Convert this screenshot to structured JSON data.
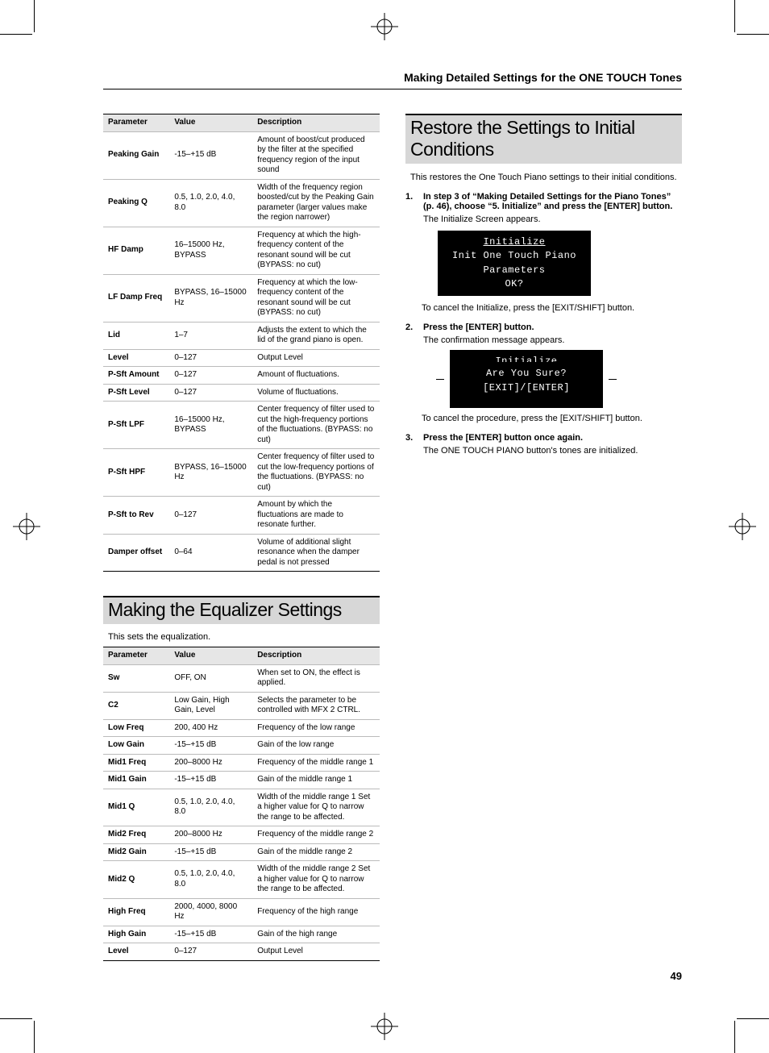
{
  "running_head": "Making Detailed Settings for the ONE TOUCH Tones",
  "page_number": "49",
  "table_top": {
    "headers": [
      "Parameter",
      "Value",
      "Description"
    ],
    "rows": [
      {
        "p": "Peaking Gain",
        "v": "-15–+15 dB",
        "d": "Amount of boost/cut produced by the filter at the specified frequency region of the input sound"
      },
      {
        "p": "Peaking Q",
        "v": "0.5, 1.0, 2.0, 4.0, 8.0",
        "d": "Width of the frequency region boosted/cut by the Peaking Gain parameter (larger values make the region narrower)"
      },
      {
        "p": "HF Damp",
        "v": "16–15000 Hz, BYPASS",
        "d": "Frequency at which the high-frequency content of the resonant sound will be cut (BYPASS: no cut)"
      },
      {
        "p": "LF Damp Freq",
        "v": "BYPASS, 16–15000 Hz",
        "d": "Frequency at which the low-frequency content of the resonant sound will be cut (BYPASS: no cut)"
      },
      {
        "p": "Lid",
        "v": "1–7",
        "d": "Adjusts the extent to which the lid of the grand piano is open."
      },
      {
        "p": "Level",
        "v": "0–127",
        "d": "Output Level"
      },
      {
        "p": "P-Sft Amount",
        "v": "0–127",
        "d": "Amount of fluctuations."
      },
      {
        "p": "P-Sft Level",
        "v": "0–127",
        "d": "Volume of fluctuations."
      },
      {
        "p": "P-Sft LPF",
        "v": "16–15000 Hz, BYPASS",
        "d": "Center frequency of filter used to cut the high-frequency portions of the fluctuations. (BYPASS: no cut)"
      },
      {
        "p": "P-Sft HPF",
        "v": "BYPASS, 16–15000 Hz",
        "d": "Center frequency of filter used to cut the low-frequency portions of the fluctuations. (BYPASS: no cut)"
      },
      {
        "p": "P-Sft to Rev",
        "v": "0–127",
        "d": "Amount by which the fluctuations are made to resonate further."
      },
      {
        "p": "Damper offset",
        "v": "0–64",
        "d": "Volume of additional slight resonance when the damper pedal is not pressed"
      }
    ]
  },
  "eq_heading": "Making the Equalizer Settings",
  "eq_intro": "This sets the equalization.",
  "table_eq": {
    "headers": [
      "Parameter",
      "Value",
      "Description"
    ],
    "rows": [
      {
        "p": "Sw",
        "v": "OFF, ON",
        "d": "When set to ON, the effect is applied."
      },
      {
        "p": "C2",
        "v": "Low Gain, High Gain, Level",
        "d": "Selects the parameter to be controlled with MFX 2 CTRL."
      },
      {
        "p": "Low Freq",
        "v": "200, 400 Hz",
        "d": "Frequency of the low range"
      },
      {
        "p": "Low Gain",
        "v": "-15–+15 dB",
        "d": "Gain of the low range"
      },
      {
        "p": "Mid1 Freq",
        "v": "200–8000 Hz",
        "d": "Frequency of the middle range 1"
      },
      {
        "p": "Mid1 Gain",
        "v": "-15–+15 dB",
        "d": "Gain of the middle range 1"
      },
      {
        "p": "Mid1 Q",
        "v": "0.5, 1.0, 2.0, 4.0, 8.0",
        "d": "Width of the middle range 1\nSet a higher value for Q to narrow the range to be affected."
      },
      {
        "p": "Mid2 Freq",
        "v": "200–8000 Hz",
        "d": "Frequency of the middle range 2"
      },
      {
        "p": "Mid2 Gain",
        "v": "-15–+15 dB",
        "d": "Gain of the middle range 2"
      },
      {
        "p": "Mid2 Q",
        "v": "0.5, 1.0, 2.0, 4.0, 8.0",
        "d": "Width of the middle range 2\nSet a higher value for Q to narrow the range to be affected."
      },
      {
        "p": "High Freq",
        "v": "2000, 4000, 8000 Hz",
        "d": "Frequency of the high range"
      },
      {
        "p": "High Gain",
        "v": "-15–+15 dB",
        "d": "Gain of the high range"
      },
      {
        "p": "Level",
        "v": "0–127",
        "d": "Output Level"
      }
    ]
  },
  "restore": {
    "heading": "Restore the Settings to Initial Conditions",
    "intro": "This restores the One Touch Piano settings to their initial conditions.",
    "step1_num": "1.",
    "step1_bold": "In step 3 of “Making Detailed Settings for the Piano Tones” (p. 46), choose “5. Initialize” and press the [ENTER] button.",
    "step1_after": "The Initialize Screen appears.",
    "lcd1_title": "Initialize",
    "lcd1_line1": "Init One Touch Piano",
    "lcd1_line2": "Parameters",
    "lcd1_line3": "OK?",
    "step1_cancel": "To cancel the Initialize, press the [EXIT/SHIFT] button.",
    "step2_num": "2.",
    "step2_bold": "Press the [ENTER] button.",
    "step2_after": "The confirmation message appears.",
    "lcd2_title": "Initialize",
    "lcd2_line1": "Are You Sure?",
    "lcd2_line2": "[EXIT]/[ENTER]",
    "step2_cancel": "To cancel the procedure, press the [EXIT/SHIFT] button.",
    "step3_num": "3.",
    "step3_bold": "Press the [ENTER] button once again.",
    "step3_after": "The ONE TOUCH PIANO button's tones are initialized."
  }
}
